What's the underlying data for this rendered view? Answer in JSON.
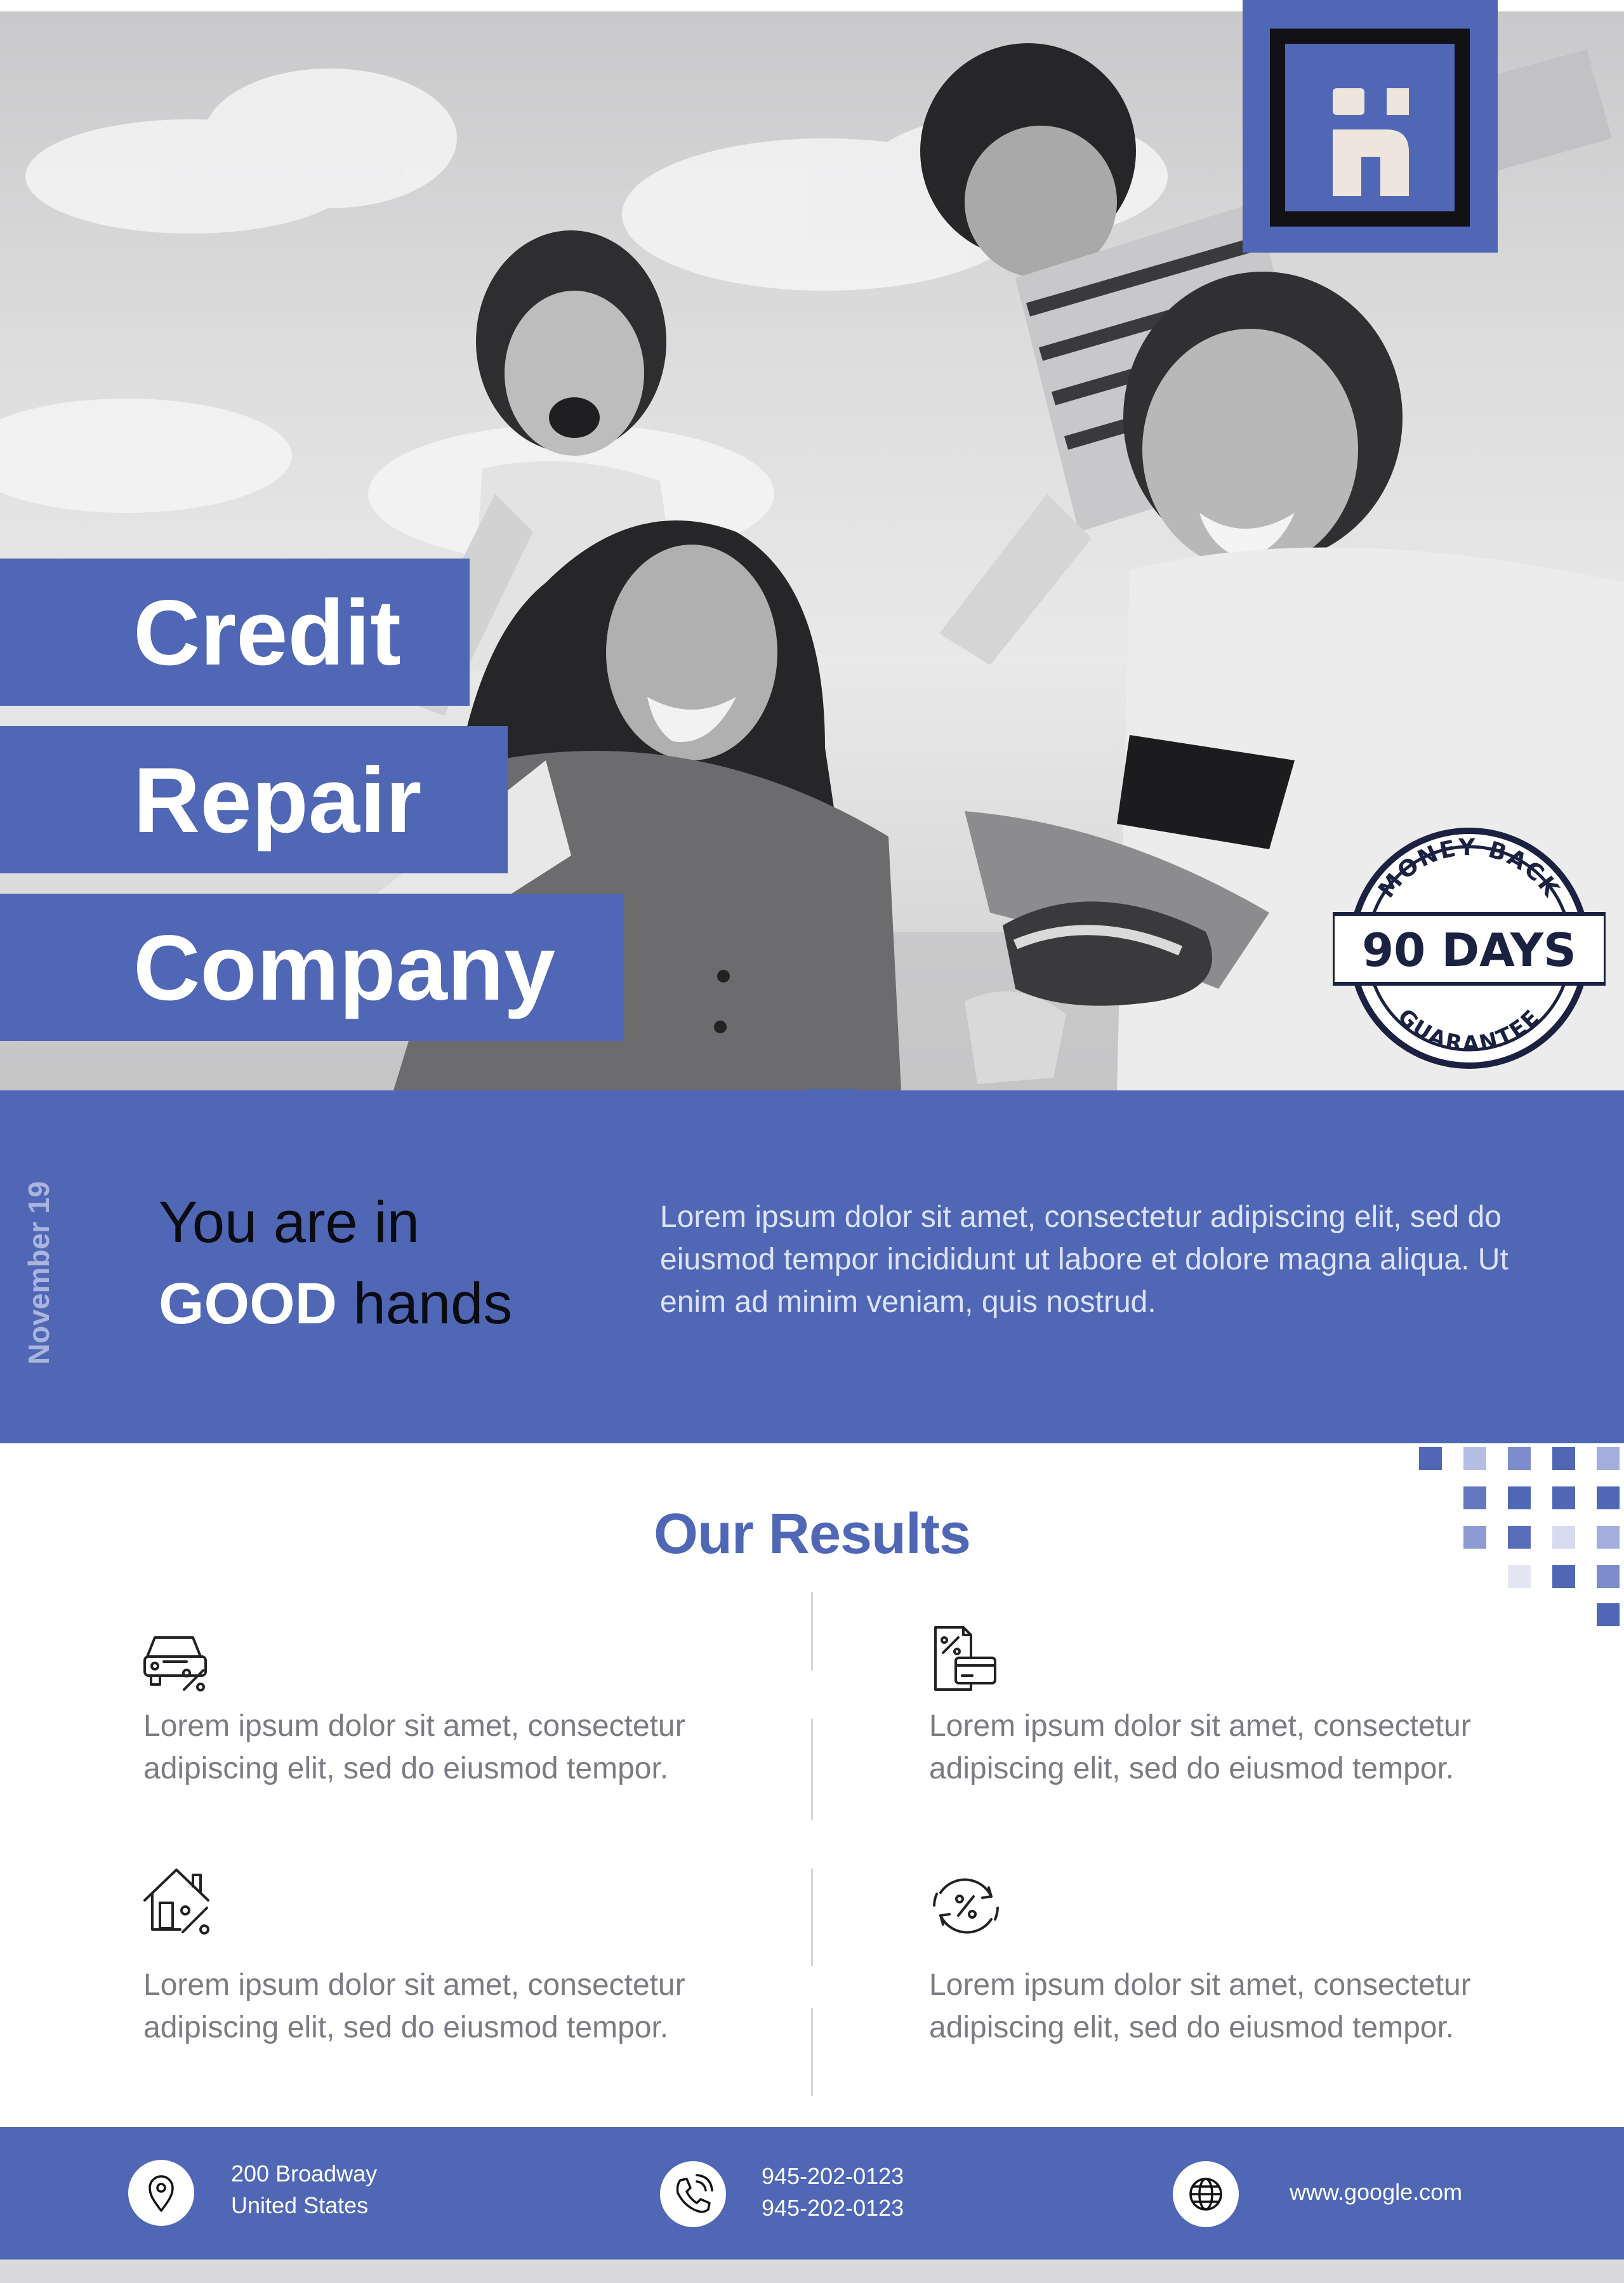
{
  "title_lines": [
    "Credit",
    "Repair",
    "Company"
  ],
  "badge": {
    "top_arc": "MONEY BACK",
    "center": "90 DAYS",
    "bottom_arc": "GUARANTEE"
  },
  "band": {
    "date": "November 19",
    "tagline_line1": "You are in",
    "tagline_strong": "GOOD",
    "tagline_rest": " hands",
    "body": "Lorem ipsum dolor sit amet, consectetur adipiscing elit, sed do eiusmod tempor incididunt ut labore et dolore magna aliqua. Ut enim ad minim veniam, quis nostrud."
  },
  "results": {
    "title": "Our Results",
    "items": [
      {
        "icon": "car-percent-icon",
        "text": "Lorem ipsum dolor sit amet, consectetur adipiscing elit, sed do eiusmod tempor."
      },
      {
        "icon": "card-percent-document-icon",
        "text": "Lorem ipsum dolor sit amet, consectetur adipiscing elit, sed do eiusmod tempor."
      },
      {
        "icon": "house-percent-icon",
        "text": "Lorem ipsum dolor sit amet, consectetur adipiscing elit, sed do eiusmod tempor."
      },
      {
        "icon": "cycle-percent-icon",
        "text": "Lorem ipsum dolor sit amet, consectetur adipiscing elit, sed do eiusmod tempor."
      }
    ]
  },
  "footer": {
    "address": [
      "200 Broadway",
      "United States"
    ],
    "phones": [
      "945-202-0123",
      "945-202-0123"
    ],
    "website": "www.google.com",
    "icons": [
      "location-pin-icon",
      "phone-icon",
      "globe-icon"
    ]
  },
  "colors": {
    "accent": "#4f67b5",
    "dark": "#111116",
    "text_muted": "#7b7b83"
  }
}
